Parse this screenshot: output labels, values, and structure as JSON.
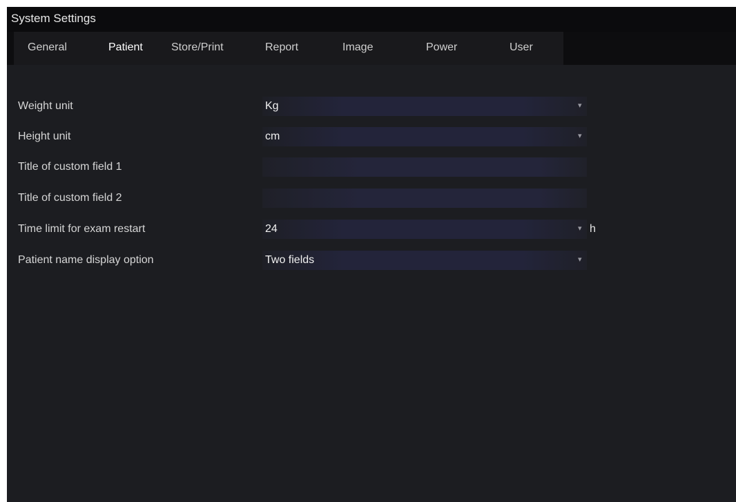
{
  "window": {
    "title": "System Settings"
  },
  "tabs": [
    {
      "label": "General",
      "active": false
    },
    {
      "label": "Patient",
      "active": true
    },
    {
      "label": "Store/Print",
      "active": false
    },
    {
      "label": "Report",
      "active": false
    },
    {
      "label": "Image",
      "active": false
    },
    {
      "label": "Power",
      "active": false
    },
    {
      "label": "User",
      "active": false
    }
  ],
  "settings": {
    "weight_unit": {
      "label": "Weight unit",
      "value": "Kg"
    },
    "height_unit": {
      "label": "Height unit",
      "value": "cm"
    },
    "custom_field_1": {
      "label": "Title of custom field 1",
      "value": ""
    },
    "custom_field_2": {
      "label": "Title of custom field 2",
      "value": ""
    },
    "exam_restart": {
      "label": "Time limit for exam restart",
      "value": "24",
      "unit": "h"
    },
    "name_display": {
      "label": "Patient name display option",
      "value": "Two fields"
    }
  },
  "icons": {
    "dropdown_arrow": "chevron-down-icon"
  },
  "colors": {
    "background": "#1c1d21",
    "title_bar": "#0b0b0d",
    "field": "#23243a",
    "text": "#d6d6d6"
  }
}
